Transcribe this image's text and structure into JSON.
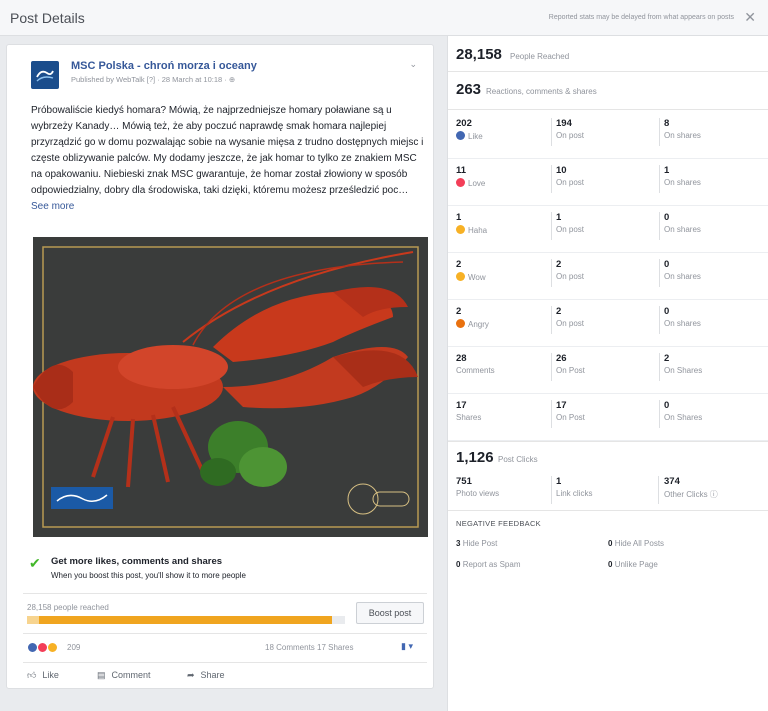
{
  "topbar": {
    "title": "Post Details",
    "note": "Reported stats may be delayed from what appears on posts",
    "close_icon": "close-icon"
  },
  "post": {
    "page_name": "MSC Polska - chroń morza i oceany",
    "published": "Published by WebTalk [?] · 28 March at 10:18 · ",
    "text": "Próbowaliście kiedyś homara? Mówią, że najprzedniejsze homary poławiane są u wybrzeży Kanady… Mówią też, że aby poczuć naprawdę smak homara najlepiej przyrządzić go w domu pozwalając sobie na wysanie mięsa z trudno dostępnych miejsc i częste oblizywanie palców. My dodamy jeszcze, że jak homar to tylko ze znakiem MSC na opakowaniu. Niebieski znak MSC gwarantuje, że homar został złowiony w sposób odpowiedzialny, dobry dla środowiska, taki dzięki, któremu możesz prześledzić poc… ",
    "see_more": "See more",
    "promo_title": "Get more likes, comments and shares",
    "promo_sub": "When you boost this post, you'll show it to more people",
    "reach_label": "28,158 people reached",
    "reach_fraction": 0.96,
    "boost_button": "Boost post",
    "reaction_count": "209",
    "comments_shares": "18 Comments  17 Shares",
    "actions": {
      "like": "Like",
      "comment": "Comment",
      "share": "Share"
    }
  },
  "stats": {
    "people_reached": {
      "value": "28,158",
      "label": "People Reached"
    },
    "engagement": {
      "value": "263",
      "label": "Reactions, comments & shares"
    },
    "rows": [
      {
        "total": "202",
        "total_label": "Like",
        "icon": "like-icon",
        "color": "#4267b2",
        "on_post": "194",
        "on_post_label": "On post",
        "on_shares": "8",
        "on_shares_label": "On shares"
      },
      {
        "total": "11",
        "total_label": "Love",
        "icon": "love-icon",
        "color": "#f33e58",
        "on_post": "10",
        "on_post_label": "On post",
        "on_shares": "1",
        "on_shares_label": "On shares"
      },
      {
        "total": "1",
        "total_label": "Haha",
        "icon": "haha-icon",
        "color": "#f7b125",
        "on_post": "1",
        "on_post_label": "On post",
        "on_shares": "0",
        "on_shares_label": "On shares"
      },
      {
        "total": "2",
        "total_label": "Wow",
        "icon": "wow-icon",
        "color": "#f7b125",
        "on_post": "2",
        "on_post_label": "On post",
        "on_shares": "0",
        "on_shares_label": "On shares"
      },
      {
        "total": "2",
        "total_label": "Angry",
        "icon": "angry-icon",
        "color": "#e9710f",
        "on_post": "2",
        "on_post_label": "On post",
        "on_shares": "0",
        "on_shares_label": "On shares"
      },
      {
        "total": "28",
        "total_label": "Comments",
        "on_post": "26",
        "on_post_label": "On Post",
        "on_shares": "2",
        "on_shares_label": "On Shares"
      },
      {
        "total": "17",
        "total_label": "Shares",
        "on_post": "17",
        "on_post_label": "On Post",
        "on_shares": "0",
        "on_shares_label": "On Shares"
      }
    ],
    "post_clicks": {
      "value": "1,126",
      "label": "Post Clicks"
    },
    "clicks": [
      {
        "value": "751",
        "label": "Photo views"
      },
      {
        "value": "1",
        "label": "Link clicks"
      },
      {
        "value": "374",
        "label": "Other Clicks ⓘ"
      }
    ],
    "negative_feedback": {
      "title": "NEGATIVE FEEDBACK",
      "items": [
        {
          "value": "3",
          "label": "Hide Post"
        },
        {
          "value": "0",
          "label": "Hide All Posts"
        },
        {
          "value": "0",
          "label": "Report as Spam"
        },
        {
          "value": "0",
          "label": "Unlike Page"
        }
      ]
    }
  }
}
